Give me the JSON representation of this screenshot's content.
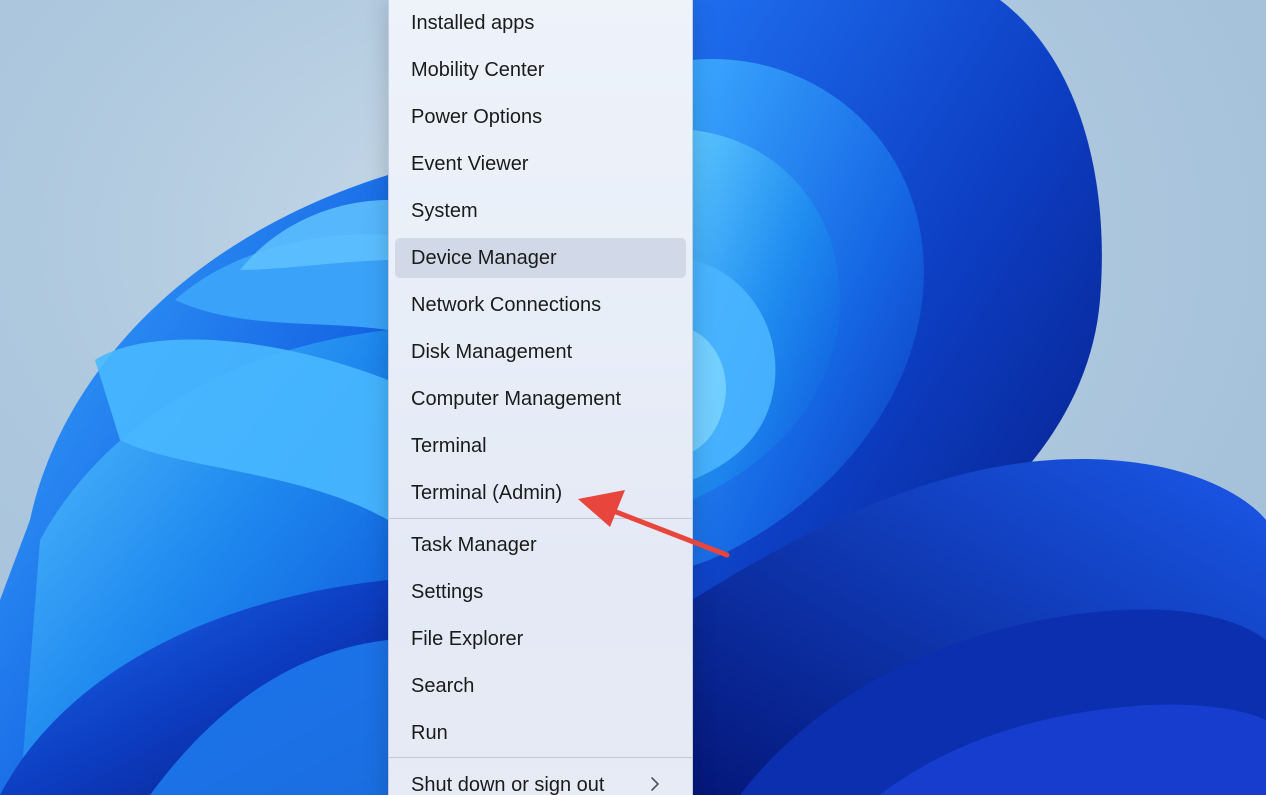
{
  "colors": {
    "annotation": "#e8453c",
    "menu_text": "#1b1b1b",
    "bloom_light": "#2fa0f5",
    "bloom_dark": "#0b2fae"
  },
  "menu": {
    "items": [
      {
        "label": "Installed apps"
      },
      {
        "label": "Mobility Center"
      },
      {
        "label": "Power Options"
      },
      {
        "label": "Event Viewer"
      },
      {
        "label": "System"
      },
      {
        "label": "Device Manager"
      },
      {
        "label": "Network Connections"
      },
      {
        "label": "Disk Management"
      },
      {
        "label": "Computer Management"
      },
      {
        "label": "Terminal"
      },
      {
        "label": "Terminal (Admin)"
      },
      {
        "label": "Task Manager"
      },
      {
        "label": "Settings"
      },
      {
        "label": "File Explorer"
      },
      {
        "label": "Search"
      },
      {
        "label": "Run"
      },
      {
        "label": "Shut down or sign out"
      }
    ],
    "hovered": "Device Manager",
    "submenu_icon": "chevron-right-icon"
  }
}
